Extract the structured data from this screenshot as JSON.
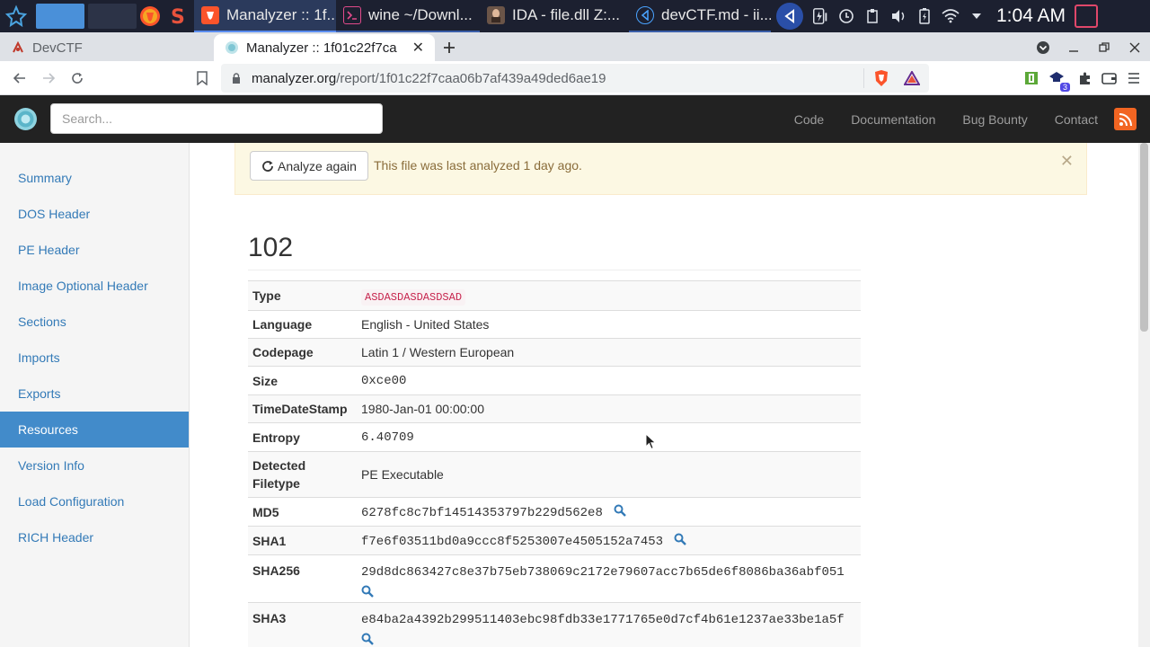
{
  "taskbar": {
    "tasks": [
      {
        "title": "Manalyzer :: 1f...",
        "icon": "brave-icon"
      },
      {
        "title": "wine ~/Downl...",
        "icon": "terminal-icon"
      },
      {
        "title": "IDA - file.dll Z:...",
        "icon": "ida-icon"
      },
      {
        "title": "devCTF.md - ii...",
        "icon": "vscode-icon"
      }
    ],
    "clock": "1:04 AM",
    "extension_badge": "3"
  },
  "browser": {
    "tabs": [
      {
        "title": "DevCTF",
        "icon": "devctf-favicon"
      },
      {
        "title": "Manalyzer :: 1f01c22f7ca",
        "icon": "manalyzer-favicon"
      }
    ],
    "address": {
      "host": "manalyzer.org",
      "path": "/report/1f01c22f7caa06b7af439a49ded6ae19"
    }
  },
  "site": {
    "search_placeholder": "Search...",
    "nav": [
      "Code",
      "Documentation",
      "Bug Bounty",
      "Contact"
    ]
  },
  "sidebar": {
    "items": [
      {
        "label": "Summary"
      },
      {
        "label": "DOS Header"
      },
      {
        "label": "PE Header"
      },
      {
        "label": "Image Optional Header"
      },
      {
        "label": "Sections"
      },
      {
        "label": "Imports"
      },
      {
        "label": "Exports"
      },
      {
        "label": "Resources",
        "active": true
      },
      {
        "label": "Version Info"
      },
      {
        "label": "Load Configuration"
      },
      {
        "label": "RICH Header"
      }
    ]
  },
  "alert": {
    "button_label": "Analyze again",
    "text": "This file was last analyzed 1 day ago."
  },
  "resource": {
    "title": "102",
    "rows": [
      {
        "key": "Type",
        "value": "ASDASDASDASDSAD"
      },
      {
        "key": "Language",
        "value": "English - United States"
      },
      {
        "key": "Codepage",
        "value": "Latin 1 / Western European"
      },
      {
        "key": "Size",
        "value": "0xce00"
      },
      {
        "key": "TimeDateStamp",
        "value": "1980-Jan-01 00:00:00"
      },
      {
        "key": "Entropy",
        "value": "6.40709"
      },
      {
        "key": "Detected Filetype",
        "value": "PE Executable"
      },
      {
        "key": "MD5",
        "value": "6278fc8c7bf14514353797b229d562e8"
      },
      {
        "key": "SHA1",
        "value": "f7e6f03511bd0a9ccc8f5253007e4505152a7453"
      },
      {
        "key": "SHA256",
        "value": "29d8dc863427c8e37b75eb738069c2172e79607acc7b65de6f8086ba36abf051"
      },
      {
        "key": "SHA3",
        "value": "e84ba2a4392b299511403ebc98fdb33e1771765e0d7cf4b61e1237ae33be1a5f"
      }
    ]
  },
  "colors": {
    "accent": "#428bca",
    "link": "#337ab7",
    "navbar": "#222222",
    "alert_bg": "#fcf8e3",
    "alert_text": "#8a6d3b",
    "code_text": "#c7254e"
  }
}
